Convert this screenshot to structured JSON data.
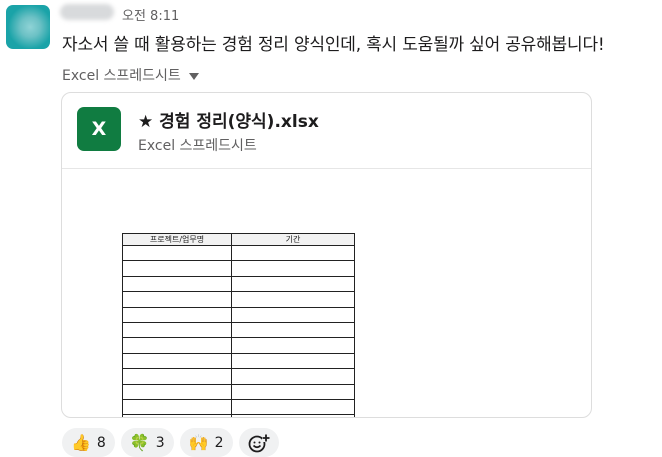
{
  "message": {
    "sender_name": "이름",
    "time": "오전 8:11",
    "text": "자소서 쓸 때 활용하는 경험 정리 양식인데, 혹시 도움될까 싶어 공유해봅니다!"
  },
  "attachment": {
    "collapse_label": "Excel 스프레드시트",
    "icon_letter": "X",
    "file_name": "★ 경험 정리(양식).xlsx",
    "file_type": "Excel 스프레드시트",
    "sheet": {
      "headers": [
        "프로젝트/업무명",
        "기간"
      ]
    }
  },
  "reactions": [
    {
      "emoji": "👍",
      "count": "8"
    },
    {
      "emoji": "🍀",
      "count": "3"
    },
    {
      "emoji": "🙌",
      "count": "2"
    }
  ],
  "colors": {
    "excel_green": "#107c41",
    "avatar_teal": "#1aa3a8",
    "reaction_bg": "#f0f1f2"
  }
}
